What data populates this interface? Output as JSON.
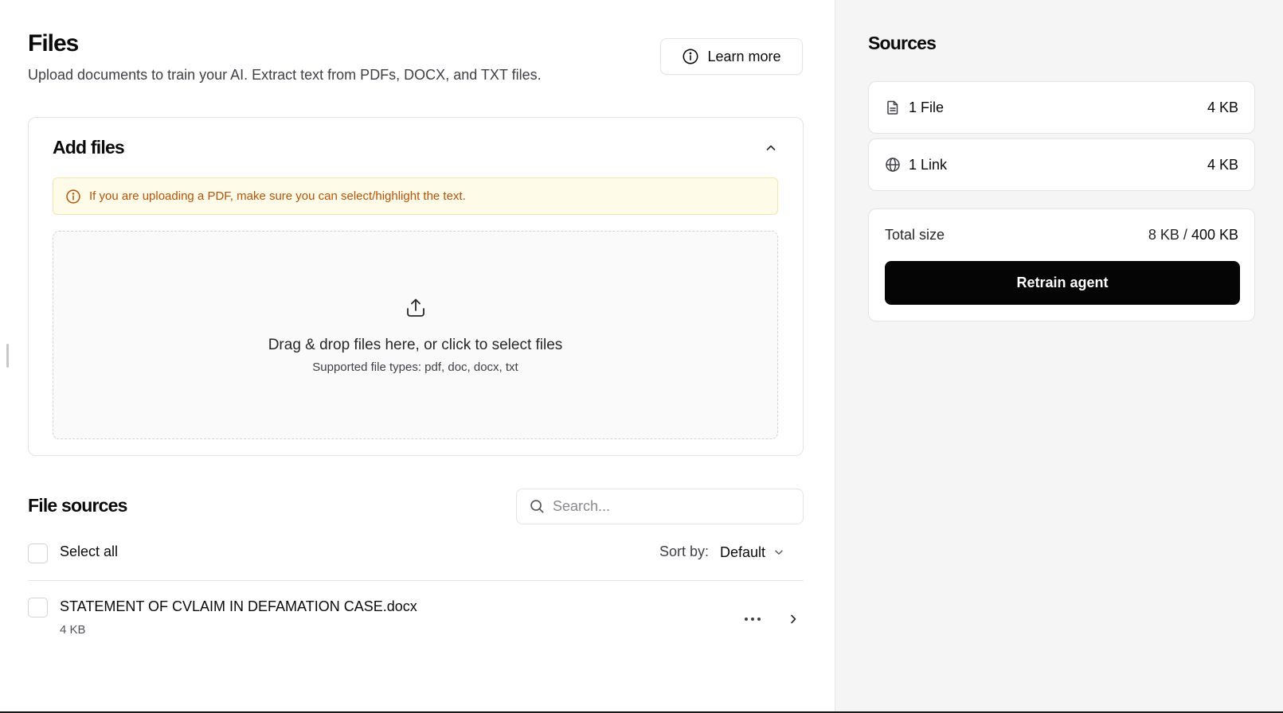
{
  "header": {
    "title": "Files",
    "subtitle": "Upload documents to train your AI. Extract text from PDFs, DOCX, and TXT files.",
    "learn_more_label": "Learn more"
  },
  "add_files": {
    "title": "Add files",
    "alert_text": "If you are uploading a PDF, make sure you can select/highlight the text.",
    "dropzone_title": "Drag & drop files here, or click to select files",
    "dropzone_subtitle": "Supported file types: pdf, doc, docx, txt"
  },
  "file_sources": {
    "title": "File sources",
    "search_placeholder": "Search...",
    "select_all_label": "Select all",
    "sort_label": "Sort by:",
    "sort_value": "Default",
    "files": [
      {
        "name": "STATEMENT OF CVLAIM IN DEFAMATION CASE.docx",
        "size": "4 KB"
      }
    ]
  },
  "sources": {
    "title": "Sources",
    "items": [
      {
        "icon": "file-icon",
        "label": "1 File",
        "size": "4 KB"
      },
      {
        "icon": "globe-icon",
        "label": "1 Link",
        "size": "4 KB"
      }
    ],
    "total_label": "Total size",
    "total_used": "8 KB",
    "total_separator": "/",
    "total_limit": "400 KB",
    "retrain_label": "Retrain agent"
  },
  "colors": {
    "alert_text": "#b45309",
    "alert_bg": "#fefbe8",
    "primary_button": "#050505",
    "aside_bg": "#f5f5f5"
  }
}
